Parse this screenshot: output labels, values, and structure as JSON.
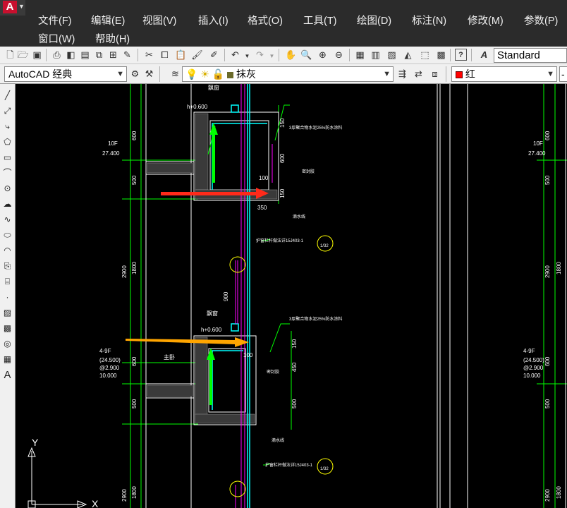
{
  "menu": {
    "items": [
      "文件(F)",
      "编辑(E)",
      "视图(V)",
      "插入(I)",
      "格式(O)",
      "工具(T)",
      "绘图(D)",
      "标注(N)",
      "修改(M)",
      "参数(P)"
    ],
    "row2": [
      "窗口(W)",
      "帮助(H)"
    ]
  },
  "toolbar": {
    "text_style": "Standard",
    "workspace": "AutoCAD 经典",
    "layer": "抹灰",
    "color": "红",
    "color_hex": "#ff0000",
    "icons": [
      "new-icon",
      "open-icon",
      "save-icon",
      "print-icon",
      "print-preview-icon",
      "publish-icon",
      "3d-print-icon",
      "batch-icon",
      "cut-icon",
      "copy-icon",
      "paste-icon",
      "match-properties-icon",
      "block-editor-icon",
      "undo-icon",
      "redo-icon",
      "pan-icon",
      "zoom-realtime-icon",
      "zoom-window-icon",
      "zoom-previous-icon",
      "properties-icon",
      "design-center-icon",
      "tool-palettes-icon",
      "sheet-set-icon",
      "markup-icon",
      "quickcalc-icon",
      "help-icon",
      "text-style-icon"
    ]
  },
  "left_tools": [
    "line-icon",
    "construction-line-icon",
    "polyline-icon",
    "polygon-icon",
    "rectangle-icon",
    "arc-icon",
    "circle-icon",
    "revcloud-icon",
    "spline-icon",
    "ellipse-icon",
    "ellipse-arc-icon",
    "insert-block-icon",
    "make-block-icon",
    "point-icon",
    "hatch-icon",
    "gradient-icon",
    "region-icon",
    "table-icon",
    "mtext-icon"
  ],
  "drawing": {
    "annotations": {
      "h_top": "h+0.600",
      "h_mid": "h+0.600",
      "room_top": "飘窗",
      "room_mid": "飘窗",
      "floor_top": "10F",
      "elev_top": "27.400",
      "floor_mid": "4-9F",
      "elev_mid_1": "(24.500)",
      "elev_mid_2": "@2.900",
      "elev_mid_3": "10.000",
      "floor_right": "10F",
      "elev_right": "27.400",
      "floor_right_mid": "4-9F",
      "elev_right_mid_1": "(24.500)",
      "elev_right_mid_2": "@2.900",
      "elev_right_mid_3": "10.000",
      "note_waterproof": "3厚聚合物水泥25%防水涂料",
      "note_waterproof_2": "3厚聚合物水泥25%防水涂料",
      "note_drip": "滴水线",
      "note_drip_2": "滴水线",
      "note_seal": "密封胶",
      "note_seal_2": "密封胶",
      "note_detail": "护窗栏杆做法详15J403-1",
      "note_detail_2": "护窗栏杆做法详15J403-1",
      "room_main": "主卧",
      "dim_600_a": "600",
      "dim_500_a": "500",
      "dim_2900_a": "2900",
      "dim_1800_a": "1800",
      "dim_600_b": "600",
      "dim_500_b": "500",
      "dim_2900_b": "2900",
      "dim_1800_b": "1800",
      "dim_150_a": "150",
      "dim_600_c": "600",
      "dim_150_b": "150",
      "dim_100_a": "100",
      "dim_350": "350",
      "dim_900": "900",
      "dim_150_c": "150",
      "dim_450": "450",
      "dim_100_b": "100",
      "dim_500_c": "500",
      "dim_600_r": "600",
      "dim_500_r": "500",
      "dim_2900_r": "2900",
      "dim_1800_r": "1800",
      "dim_600_r2": "600",
      "dim_500_r2": "500",
      "dim_2900_r2": "2900",
      "dim_1800_r2": "1800",
      "detail_ref": "1/32",
      "detail_ref_2": "1/32"
    },
    "ucs": {
      "x_label": "X",
      "y_label": "Y"
    }
  },
  "colors": {
    "background": "#000000",
    "wall_outline": "#ffffff",
    "green": "#00ff00",
    "cyan": "#00ffff",
    "magenta": "#ff00ff",
    "yellow": "#ffff00",
    "red_arrow": "#ff2a1a",
    "orange_arrow": "#ffa500"
  }
}
